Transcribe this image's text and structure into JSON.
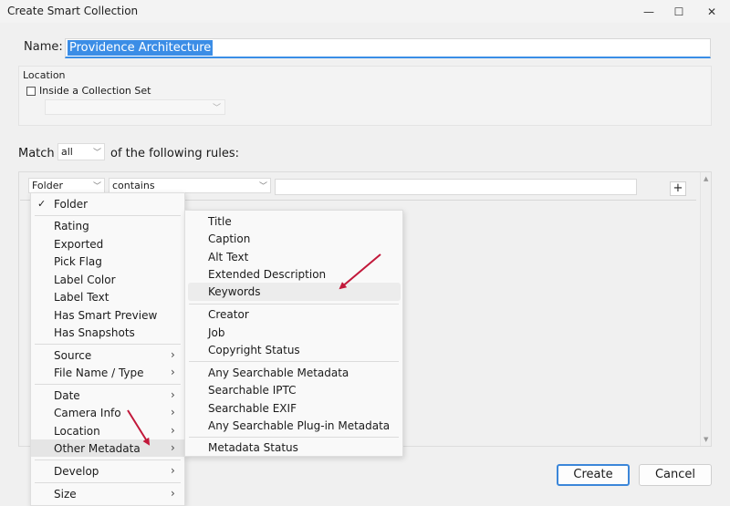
{
  "window": {
    "title": "Create Smart Collection",
    "controls": {
      "minimize": "—",
      "maximize": "☐",
      "close": "✕"
    }
  },
  "name": {
    "label": "Name:",
    "value": "Providence Architecture"
  },
  "location": {
    "label": "Location",
    "inside_set_label": "Inside a Collection Set",
    "inside_set_checked": false,
    "collection_set_value": ""
  },
  "match": {
    "prefix": "Match",
    "value": "all",
    "suffix": "of the following rules:"
  },
  "rule": {
    "field": "Folder",
    "operator": "contains",
    "value": "",
    "add_label": "+"
  },
  "field_menu": {
    "checked_item": "Folder",
    "groups": [
      [
        "Folder"
      ],
      [
        "Rating",
        "Exported",
        "Pick Flag",
        "Label Color",
        "Label Text",
        "Has Smart Preview",
        "Has Snapshots"
      ],
      [
        "Source",
        "File Name / Type"
      ],
      [
        "Date",
        "Camera Info",
        "Location",
        "Other Metadata"
      ],
      [
        "Develop"
      ],
      [
        "Size"
      ]
    ],
    "highlighted": "Other Metadata"
  },
  "other_metadata_submenu": {
    "groups": [
      [
        "Title",
        "Caption",
        "Alt Text",
        "Extended Description",
        "Keywords"
      ],
      [
        "Creator",
        "Job",
        "Copyright Status"
      ],
      [
        "Any Searchable Metadata",
        "Searchable IPTC",
        "Searchable EXIF",
        "Any Searchable Plug-in Metadata"
      ],
      [
        "Metadata Status"
      ]
    ],
    "highlighted": "Keywords"
  },
  "buttons": {
    "create": "Create",
    "cancel": "Cancel"
  },
  "colors": {
    "accent": "#3b8de6",
    "annotation_arrow": "#c2183a"
  }
}
